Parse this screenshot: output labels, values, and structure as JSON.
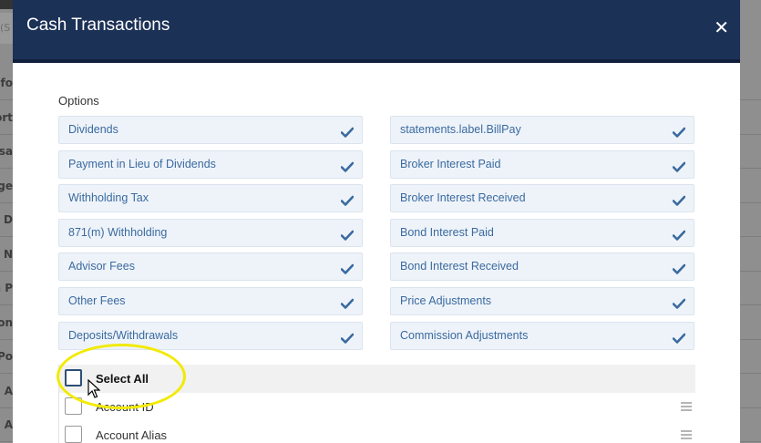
{
  "background": {
    "search_placeholder": "(S",
    "nav_items": [
      "nfo",
      "ort",
      "nsa",
      "ge",
      "n D",
      "n N",
      "n P",
      "ion",
      "Po",
      "e A",
      "d A"
    ]
  },
  "modal": {
    "title": "Cash Transactions",
    "close_glyph": "✕",
    "options_label": "Options",
    "left_options": [
      {
        "label": "Dividends",
        "checked": true
      },
      {
        "label": "Payment in Lieu of Dividends",
        "checked": true
      },
      {
        "label": "Withholding Tax",
        "checked": true
      },
      {
        "label": "871(m) Withholding",
        "checked": true
      },
      {
        "label": "Advisor Fees",
        "checked": true
      },
      {
        "label": "Other Fees",
        "checked": true
      },
      {
        "label": "Deposits/Withdrawals",
        "checked": true
      }
    ],
    "right_options": [
      {
        "label": "statements.label.BillPay",
        "checked": true
      },
      {
        "label": "Broker Interest Paid",
        "checked": true
      },
      {
        "label": "Broker Interest Received",
        "checked": true
      },
      {
        "label": "Bond Interest Paid",
        "checked": true
      },
      {
        "label": "Bond Interest Received",
        "checked": true
      },
      {
        "label": "Price Adjustments",
        "checked": true
      },
      {
        "label": "Commission Adjustments",
        "checked": true
      }
    ],
    "select_all_label": "Select All",
    "fields": [
      {
        "label": "Account ID",
        "checked": false
      },
      {
        "label": "Account Alias",
        "checked": false
      }
    ]
  },
  "colors": {
    "header_bg": "#1c3156",
    "option_text": "#3a6aa0",
    "checkmark": "#3a6aa0",
    "highlight": "#f2ea00"
  }
}
